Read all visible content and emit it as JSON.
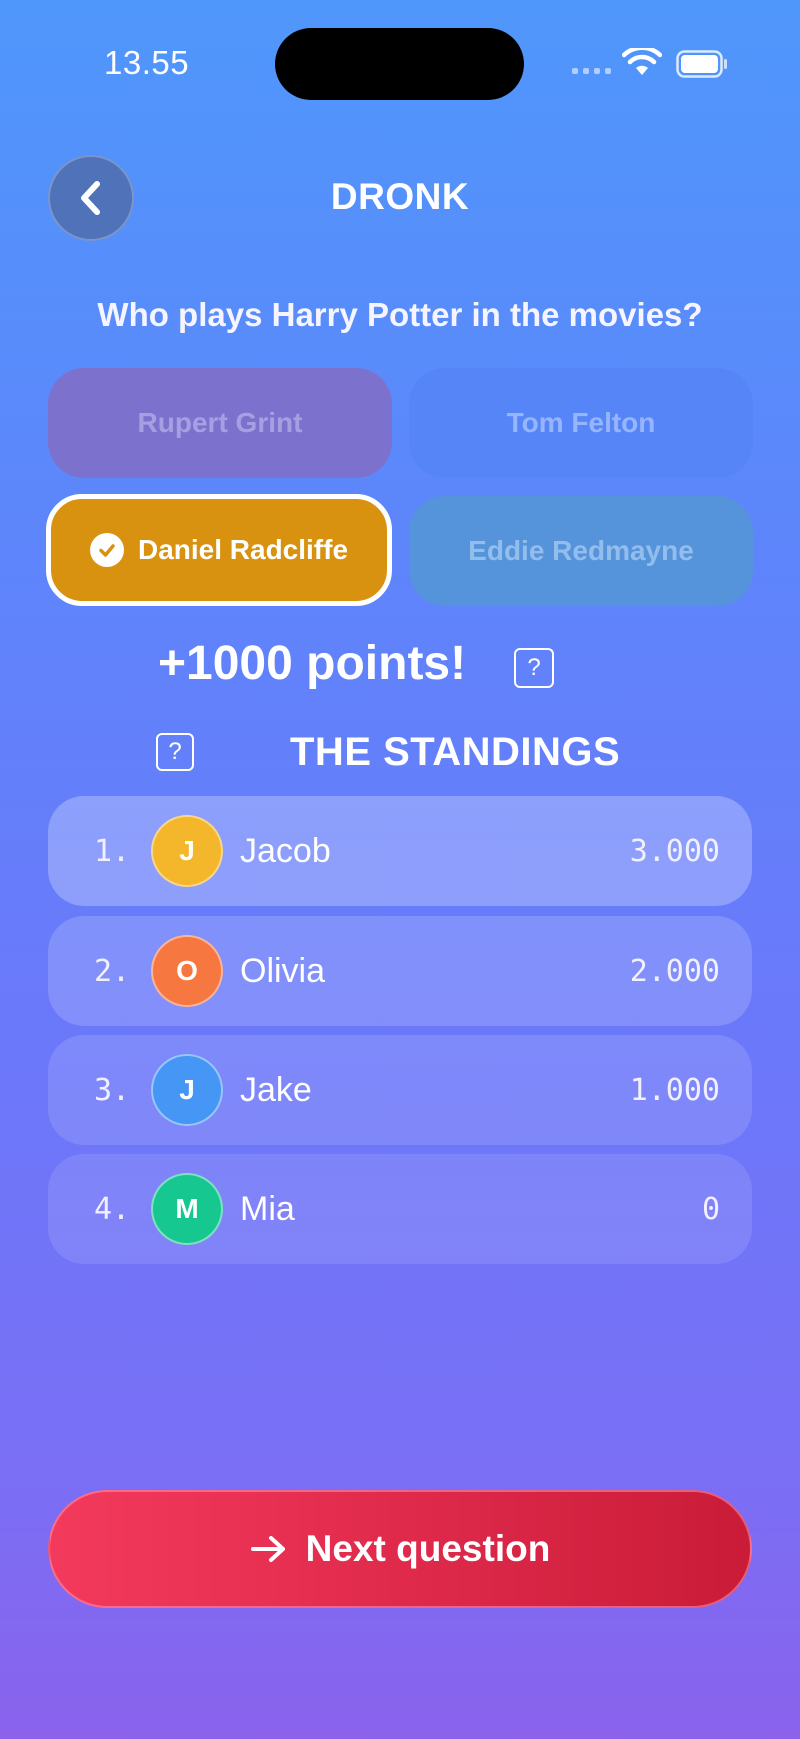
{
  "status_bar": {
    "time": "13.55"
  },
  "header": {
    "title": "DRONK"
  },
  "question": "Who plays Harry Potter in the movies?",
  "answers": [
    {
      "label": "Rupert Grint",
      "state": "dimmed"
    },
    {
      "label": "Tom Felton",
      "state": "dimmed"
    },
    {
      "label": "Daniel Radcliffe",
      "state": "selected-correct"
    },
    {
      "label": "Eddie Redmayne",
      "state": "dimmed"
    }
  ],
  "result": {
    "points_text": "+1000 points!",
    "help_glyph": "?"
  },
  "standings": {
    "title": "THE STANDINGS",
    "help_glyph": "?",
    "players": [
      {
        "rank": "1.",
        "initial": "J",
        "name": "Jacob",
        "score": "3.000",
        "color": "#f4b62a"
      },
      {
        "rank": "2.",
        "initial": "O",
        "name": "Olivia",
        "score": "2.000",
        "color": "#f77741"
      },
      {
        "rank": "3.",
        "initial": "J",
        "name": "Jake",
        "score": "1.000",
        "color": "#4596f5"
      },
      {
        "rank": "4.",
        "initial": "M",
        "name": "Mia",
        "score": "0",
        "color": "#16c88f"
      }
    ]
  },
  "footer": {
    "next_label": "Next question"
  }
}
